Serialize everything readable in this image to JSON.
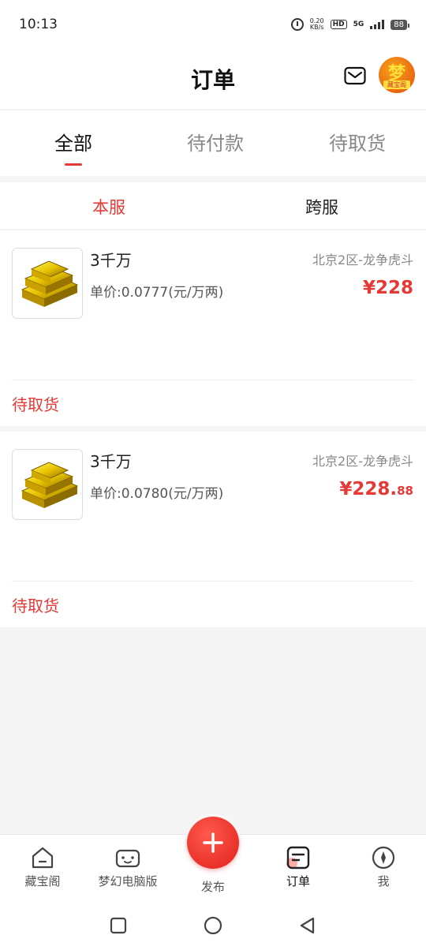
{
  "status_bar": {
    "time": "10:13",
    "net_speed_value": "0.20",
    "net_speed_unit": "KB/s",
    "hd": "HD",
    "network": "5G",
    "battery": "88"
  },
  "header": {
    "title": "订单",
    "avatar_char": "梦",
    "avatar_sub": "藏宝阁"
  },
  "tabs": [
    {
      "label": "全部"
    },
    {
      "label": "待付款"
    },
    {
      "label": "待取货"
    }
  ],
  "subtabs": [
    {
      "label": "本服"
    },
    {
      "label": "跨服"
    }
  ],
  "orders": [
    {
      "title": "3千万",
      "server": "北京2区-龙争虎斗",
      "unit_price": "单价:0.0777(元/万两)",
      "price_main": "¥228",
      "price_cents": "",
      "status": "待取货"
    },
    {
      "title": "3千万",
      "server": "北京2区-龙争虎斗",
      "unit_price": "单价:0.0780(元/万两)",
      "price_main": "¥228.",
      "price_cents": "88",
      "status": "待取货"
    }
  ],
  "bottom_nav": {
    "items": [
      {
        "label": "藏宝阁",
        "icon": "home-icon"
      },
      {
        "label": "梦幻电脑版",
        "icon": "gamepad-icon"
      },
      {
        "label": "订单",
        "icon": "order-icon"
      },
      {
        "label": "我",
        "icon": "compass-icon"
      }
    ],
    "publish_label": "发布"
  },
  "colors": {
    "accent": "#e53935",
    "muted": "#888888"
  }
}
